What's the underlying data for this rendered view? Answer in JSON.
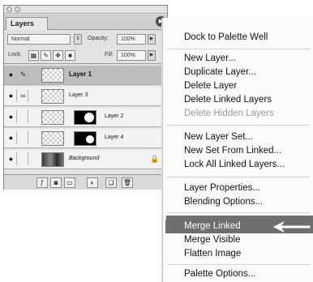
{
  "palette": {
    "tab_label": "Layers",
    "blend_mode": "Normal",
    "opacity_label": "Opacity:",
    "opacity_value": "100%",
    "lock_label": "Lock:",
    "fill_label": "Fill:",
    "fill_value": "100%",
    "layers": [
      {
        "name": "Layer 1",
        "visible": true,
        "active": true
      },
      {
        "name": "Layer 3",
        "visible": true,
        "active": false
      },
      {
        "name": "Layer 2",
        "visible": true,
        "active": false
      },
      {
        "name": "Layer 4",
        "visible": true,
        "active": false
      },
      {
        "name": "Background",
        "visible": true,
        "active": false,
        "locked": true
      }
    ]
  },
  "menu": {
    "items": [
      "Dock to Palette Well",
      "New Layer...",
      "Duplicate Layer...",
      "Delete Layer",
      "Delete Linked Layers",
      "Delete Hidden Layers",
      "New Layer Set...",
      "New Set From Linked...",
      "Lock All Linked Layers...",
      "Layer Properties...",
      "Blending Options...",
      "Merge Linked",
      "Merge Visible",
      "Flatten Image",
      "Palette Options..."
    ],
    "highlighted": "Merge Linked",
    "disabled": [
      "Delete Hidden Layers"
    ]
  },
  "colors": {
    "highlight": "#6e6e6e",
    "active_layer": "#bdbdbd"
  }
}
